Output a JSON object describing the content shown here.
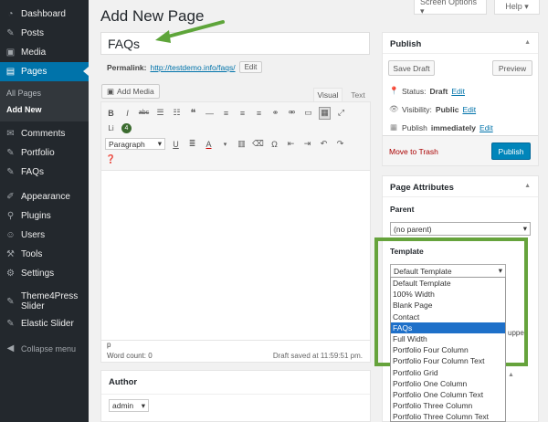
{
  "sidebar": {
    "items": [
      {
        "label": "Dashboard",
        "icon": "dashboard-icon",
        "glyph": "◔"
      },
      {
        "label": "Posts",
        "icon": "pin-icon",
        "glyph": "✎"
      },
      {
        "label": "Media",
        "icon": "media-icon",
        "glyph": "▣"
      },
      {
        "label": "Pages",
        "icon": "pages-icon",
        "glyph": "▤"
      }
    ],
    "submenu": [
      "All Pages",
      "Add New"
    ],
    "items2": [
      {
        "label": "Comments",
        "icon": "comment-icon",
        "glyph": "✉"
      },
      {
        "label": "Portfolio",
        "icon": "pin-icon",
        "glyph": "✎"
      },
      {
        "label": "FAQs",
        "icon": "pin-icon",
        "glyph": "✎"
      },
      {
        "label": "Appearance",
        "icon": "brush-icon",
        "glyph": "✐"
      },
      {
        "label": "Plugins",
        "icon": "plugin-icon",
        "glyph": "⚲"
      },
      {
        "label": "Users",
        "icon": "user-icon",
        "glyph": "☺"
      },
      {
        "label": "Tools",
        "icon": "wrench-icon",
        "glyph": "⚒"
      },
      {
        "label": "Settings",
        "icon": "settings-icon",
        "glyph": "⚙"
      },
      {
        "label": "Theme4Press Slider",
        "icon": "pin-icon",
        "glyph": "✎"
      },
      {
        "label": "Elastic Slider",
        "icon": "pin-icon",
        "glyph": "✎"
      },
      {
        "label": "Collapse menu",
        "icon": "collapse-icon",
        "glyph": "◀"
      }
    ]
  },
  "top": {
    "screen_options": "Screen Options ▾",
    "help": "Help ▾"
  },
  "page_title": "Add New Page",
  "title_value": "FAQs",
  "permalink": {
    "label": "Permalink:",
    "url": "http://testdemo.info/faqs/",
    "edit": "Edit"
  },
  "editor": {
    "add_media": "Add Media",
    "tab_visual": "Visual",
    "tab_text": "Text",
    "paragraph": "Paragraph",
    "badge": "4",
    "path": "p",
    "word_count": "Word count: 0",
    "saved": "Draft saved at 11:59:51 pm."
  },
  "author": {
    "title": "Author",
    "value": "admin"
  },
  "publish": {
    "title": "Publish",
    "save_draft": "Save Draft",
    "preview": "Preview",
    "status_label": "Status:",
    "status_value": "Draft",
    "visibility_label": "Visibility:",
    "visibility_value": "Public",
    "publish_label": "Publish",
    "publish_value": "immediately",
    "edit": "Edit",
    "trash": "Move to Trash",
    "publish_btn": "Publish"
  },
  "attributes": {
    "title": "Page Attributes",
    "parent_label": "Parent",
    "parent_value": "(no parent)",
    "template_label": "Template",
    "template_value": "Default Template",
    "behind_text": "uppe",
    "options": [
      "Default Template",
      "100% Width",
      "Blank Page",
      "Contact",
      "FAQs",
      "Full Width",
      "Portfolio Four Column",
      "Portfolio Four Column Text",
      "Portfolio Grid",
      "Portfolio One Column",
      "Portfolio One Column Text",
      "Portfolio Three Column",
      "Portfolio Three Column Text"
    ],
    "selected_option": "FAQs"
  },
  "colors": {
    "accent": "#0073aa",
    "highlight_box": "#66a33c",
    "arrow": "#5ea53a",
    "selected": "#1e70c9"
  }
}
